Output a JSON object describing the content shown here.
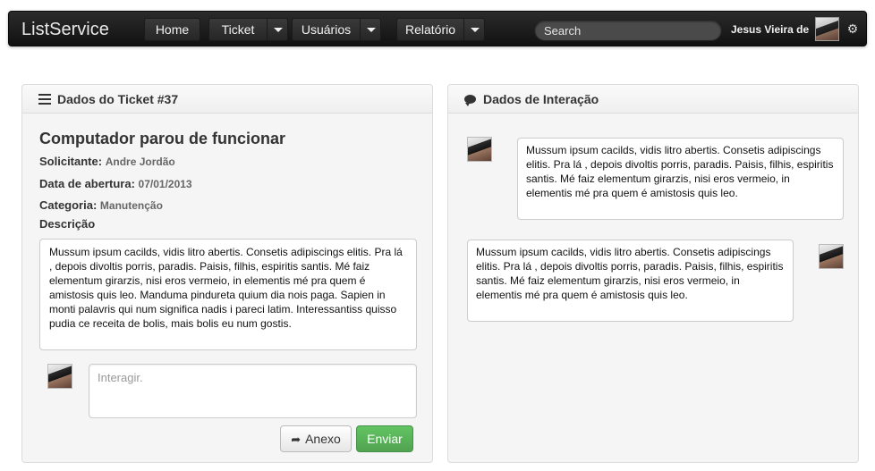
{
  "navbar": {
    "brand": "ListService",
    "items": [
      {
        "label": "Home"
      },
      {
        "label": "Ticket"
      },
      {
        "label": "Usuários"
      },
      {
        "label": "Relatório"
      }
    ],
    "search_placeholder": "Search",
    "user_name": "Jesus Vieira de",
    "icons": {
      "avatar": "user-photo",
      "settings": "gear-icon"
    }
  },
  "ticket_panel": {
    "heading": "Dados do Ticket #37",
    "heading_icon": "list-icon",
    "title": "Computador parou de funcionar",
    "fields": {
      "solicitante_label": "Solicitante:",
      "solicitante_value": "Andre Jordão",
      "abertura_label": "Data de abertura:",
      "abertura_value": "07/01/2013",
      "categoria_label": "Categoria:",
      "categoria_value": "Manutenção",
      "descricao_label": "Descrição"
    },
    "descricao": "Mussum ipsum cacilds, vidis litro abertis. Consetis adipiscings elitis. Pra lá , depois divoltis porris, paradis. Paisis, filhis, espiritis santis. Mé faiz elementum girarzis, nisi eros vermeio, in elementis mé pra quem é amistosis quis leo. Manduma pindureta quium dia nois paga. Sapien in monti palavris qui num significa nadis i pareci latim. Interessantiss quisso pudia ce receita de bolis, mais bolis eu num gostis.",
    "interact_placeholder": "Interagir.",
    "anexo_label": "Anexo",
    "enviar_label": "Enviar",
    "colors": {
      "enviar": "#5bb75b"
    }
  },
  "interaction_panel": {
    "heading": "Dados de Interação",
    "heading_icon": "comment-icon",
    "messages": [
      {
        "side": "left-avatar",
        "text": "Mussum ipsum cacilds, vidis litro abertis. Consetis adipiscings elitis. Pra lá , depois divoltis porris, paradis. Paisis, filhis, espiritis santis. Mé faiz elementum girarzis, nisi eros vermeio, in elementis mé pra quem é amistosis quis leo."
      },
      {
        "side": "right-avatar",
        "text": "Mussum ipsum cacilds, vidis litro abertis. Consetis adipiscings elitis. Pra lá , depois divoltis porris, paradis. Paisis, filhis, espiritis santis. Mé faiz elementum girarzis, nisi eros vermeio, in elementis mé pra quem é amistosis quis leo."
      }
    ]
  }
}
